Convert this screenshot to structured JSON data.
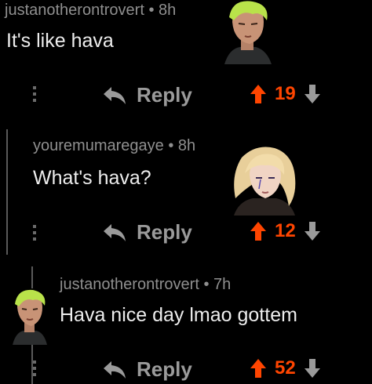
{
  "comments": [
    {
      "username": "justanotherontrovert",
      "time": "8h",
      "body": "It's like hava",
      "reply_label": "Reply",
      "score": "19",
      "avatar": "green-hair-man-avatar"
    },
    {
      "username": "youremumaregaye",
      "time": "8h",
      "body": "What's hava?",
      "reply_label": "Reply",
      "score": "12",
      "avatar": "blonde-woman-avatar"
    },
    {
      "username": "justanotherontrovert",
      "time": "7h",
      "body": "Hava nice day lmao gottem",
      "reply_label": "Reply",
      "score": "52",
      "avatar": "green-hair-man-avatar"
    }
  ],
  "separator": "•",
  "colors": {
    "background": "#000000",
    "username": "#8f8f8f",
    "body_text": "#ededed",
    "upvote": "#ff4500",
    "muted": "#9a9a9a"
  }
}
